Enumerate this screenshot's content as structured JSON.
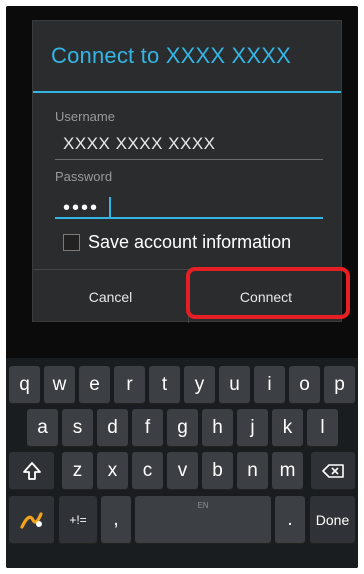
{
  "dialog": {
    "title": "Connect to XXXX XXXX",
    "username_label": "Username",
    "username_value": "XXXX XXXX XXXX",
    "password_label": "Password",
    "password_value": "••••",
    "save_account_label": "Save account information",
    "cancel_label": "Cancel",
    "connect_label": "Connect"
  },
  "keyboard": {
    "row1": [
      "q",
      "w",
      "e",
      "r",
      "t",
      "y",
      "u",
      "i",
      "o",
      "p"
    ],
    "row2": [
      "a",
      "s",
      "d",
      "f",
      "g",
      "h",
      "j",
      "k",
      "l"
    ],
    "row3": [
      "z",
      "x",
      "c",
      "v",
      "b",
      "n",
      "m"
    ],
    "symbols_label": "+!=",
    "comma_label": ",",
    "space_hint": "EN",
    "period_label": ".",
    "done_label": "Done"
  },
  "colors": {
    "accent": "#33b5e5",
    "highlight": "#e51f24"
  }
}
